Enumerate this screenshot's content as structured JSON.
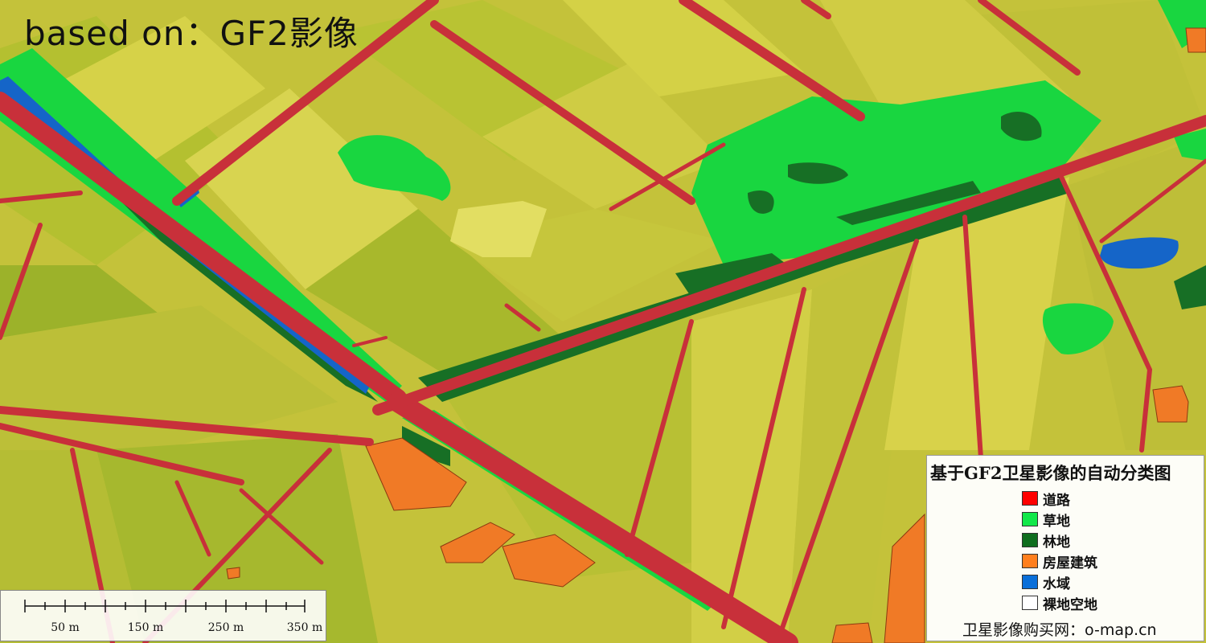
{
  "caption": "based on：GF2影像",
  "legend": {
    "title": "基于GF2卫星影像的自动分类图",
    "items": [
      {
        "label": "道路",
        "color": "#ff0000"
      },
      {
        "label": "草地",
        "color": "#12e84a"
      },
      {
        "label": "林地",
        "color": "#0f6e1f"
      },
      {
        "label": "房屋建筑",
        "color": "#ff7f1e"
      },
      {
        "label": "水域",
        "color": "#0a6fd9"
      },
      {
        "label": "裸地空地",
        "color": "#ffffff"
      }
    ],
    "footer": "卫星影像购买网：o-map.cn"
  },
  "scalebar": {
    "labels": [
      "50 m",
      "150 m",
      "250 m",
      "350 m"
    ]
  },
  "colors": {
    "road": "#c8303a",
    "grassland": "#19d640",
    "forest": "#176f25",
    "building": "#f07a26",
    "water": "#1565c8",
    "crop_light": "#d8d44a",
    "crop_mid": "#b6c232",
    "crop_dark": "#8aa626"
  }
}
